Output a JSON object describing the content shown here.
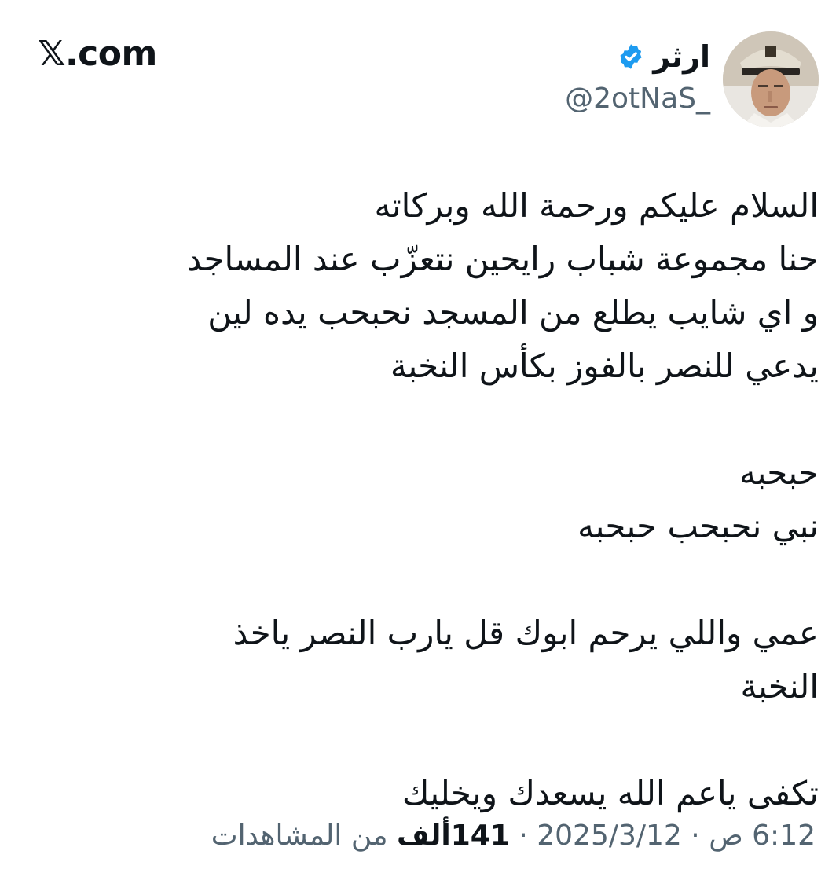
{
  "site_logo": "𝕏.com",
  "author": {
    "display_name": "ارثر",
    "handle": "@2otNaS_",
    "verified": true
  },
  "tweet": {
    "lines": [
      "السلام عليكم ورحمة الله وبركاته",
      "حنا مجموعة شباب رايحين نتعزّب عند المساجد",
      "و اي شايب يطلع من المسجد نحبحب يده لين",
      "يدعي للنصر بالفوز بكأس النخبة",
      "",
      "حبحبه",
      "نبي نحبحب حبحبه",
      "",
      "عمي واللي يرحم ابوك قل يارب النصر ياخذ",
      "النخبة",
      "",
      "تكفى ياعم الله يسعدك ويخليك"
    ]
  },
  "meta": {
    "time": "6:12 ص",
    "separator": "·",
    "date": "2025/3/12",
    "views_count": "141ألف",
    "views_label": "من المشاهدات"
  },
  "colors": {
    "text": "#0f1419",
    "secondary": "#536471",
    "verified_blue": "#1d9bf0"
  }
}
